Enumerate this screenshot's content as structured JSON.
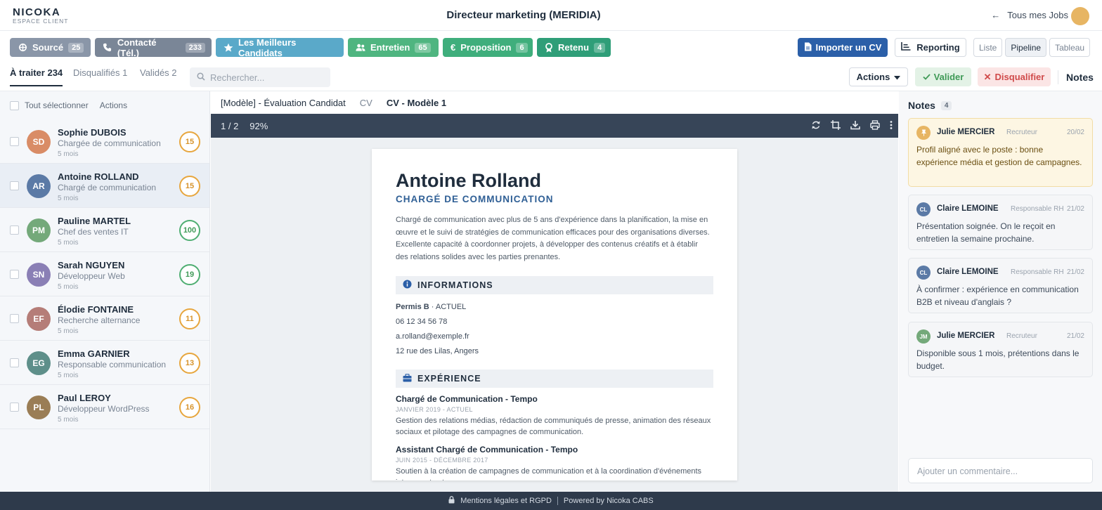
{
  "brand": {
    "name": "NICOKA",
    "sub": "ESPACE CLIENT"
  },
  "header": {
    "title": "Directeur marketing (MERIDIA)",
    "back_label": "Tous mes Jobs"
  },
  "stages": [
    {
      "label": "Sourcé",
      "count": "25",
      "color": "#8a96a8",
      "icon": "crosshair-icon"
    },
    {
      "label": "Contacté (Tél.)",
      "count": "233",
      "color": "#7a8697",
      "icon": "phone-icon"
    },
    {
      "label": "Les Meilleurs Candidats",
      "count": "",
      "color": "#5aa9c9",
      "icon": "star-icon"
    },
    {
      "label": "Entretien",
      "count": "65",
      "color": "#4fb580",
      "icon": "users-icon"
    },
    {
      "label": "Proposition",
      "count": "6",
      "color": "#3fae7c",
      "icon": "euro-icon"
    },
    {
      "label": "Retenu",
      "count": "4",
      "color": "#2f9e78",
      "icon": "award-icon"
    }
  ],
  "toolbar": {
    "import_label": "Importer un CV",
    "report_label": "Reporting",
    "views": [
      "Liste",
      "Pipeline",
      "Tableau"
    ],
    "active_view": "Pipeline"
  },
  "tabs": {
    "todo": "À traiter 234",
    "disqualified": "Disqualifiés 1",
    "validated": "Validés 2"
  },
  "search": {
    "placeholder": "Rechercher..."
  },
  "actions": {
    "actions_label": "Actions",
    "validate_label": "Valider",
    "disqualify_label": "Disqualifier",
    "notes_label": "Notes"
  },
  "list": {
    "select_all": "Tout sélectionner",
    "actions": "Actions"
  },
  "candidates": [
    {
      "initials": "SD",
      "name": "Sophie DUBOIS",
      "job": "Chargée de communication",
      "age": "5 mois",
      "score": "15",
      "color": "#d98c66"
    },
    {
      "initials": "AR",
      "name": "Antoine ROLLAND",
      "job": "Chargé de communication",
      "age": "5 mois",
      "score": "15",
      "color": "#5b7aa6",
      "selected": true
    },
    {
      "initials": "PM",
      "name": "Pauline MARTEL",
      "job": "Chef des ventes IT",
      "age": "5 mois",
      "score": "100",
      "color": "#74a97a"
    },
    {
      "initials": "SN",
      "name": "Sarah NGUYEN",
      "job": "Développeur Web",
      "age": "5 mois",
      "score": "19",
      "color": "#8a7fb5"
    },
    {
      "initials": "EF",
      "name": "Élodie FONTAINE",
      "job": "Recherche alternance",
      "age": "5 mois",
      "score": "11",
      "color": "#b57d78"
    },
    {
      "initials": "EG",
      "name": "Emma GARNIER",
      "job": "Responsable communication",
      "age": "5 mois",
      "score": "13",
      "color": "#5e8f8a"
    },
    {
      "initials": "PL",
      "name": "Paul LEROY",
      "job": "Développeur WordPress",
      "age": "5 mois",
      "score": "16",
      "color": "#9a7d55"
    }
  ],
  "doc_tabs": {
    "t1": "[Modèle] - Évaluation Candidat",
    "t2": "CV",
    "t3": "CV - Modèle 1"
  },
  "viewer": {
    "page": "1 / 2",
    "zoom": "92%"
  },
  "cv": {
    "name": "Antoine Rolland",
    "role": "CHARGÉ DE COMMUNICATION",
    "summary": "Chargé de communication avec plus de 5 ans d'expérience dans la planification, la mise en œuvre et le suivi de stratégies de communication efficaces pour des organisations diverses. Excellente capacité à coordonner projets, à développer des contenus créatifs et à établir des relations solides avec les parties prenantes.",
    "info_title": "INFORMATIONS",
    "license": "Permis B",
    "license_status": " · ACTUEL",
    "phone": "06 12 34 56 78",
    "email": "a.rolland@exemple.fr",
    "address": "12 rue des Lilas, Angers",
    "exp_title": "EXPÉRIENCE",
    "experiences": [
      {
        "title": "Chargé de Communication - Tempo",
        "dates": "JANVIER 2019 - ACTUEL",
        "text": "Gestion des relations médias, rédaction de communiqués de presse, animation des réseaux sociaux et pilotage des campagnes de communication."
      },
      {
        "title": "Assistant Chargé de Communication - Tempo",
        "dates": "JUIN 2015 - DÉCEMBRE 2017",
        "text": "Soutien à la création de campagnes de communication et à la coordination d'événements internes et externes."
      }
    ]
  },
  "notes": {
    "title": "Notes",
    "count": "4",
    "items": [
      {
        "initials": "",
        "author": "Julie MERCIER",
        "role": "Recruteur",
        "date": "20/02",
        "text": "Profil aligné avec le poste : bonne expérience média et gestion de campagnes.",
        "color": "#e7b563"
      },
      {
        "initials": "CL",
        "author": "Claire LEMOINE",
        "role": "Responsable RH",
        "date": "21/02",
        "text": "Présentation soignée. On le reçoit en entretien la semaine prochaine.",
        "color": "#5b7aa6"
      },
      {
        "initials": "CL",
        "author": "Claire LEMOINE",
        "role": "Responsable RH",
        "date": "21/02",
        "text": "À confirmer : expérience en communication B2B et niveau d'anglais ?",
        "color": "#5b7aa6"
      },
      {
        "initials": "JM",
        "author": "Julie MERCIER",
        "role": "Recruteur",
        "date": "21/02",
        "text": "Disponible sous 1 mois, prétentions dans le budget.",
        "color": "#74a97a"
      }
    ],
    "comment_placeholder": "Ajouter un commentaire..."
  },
  "footer": {
    "legal": "Mentions légales et RGPD",
    "powered": "Powered by Nicoka CABS"
  }
}
